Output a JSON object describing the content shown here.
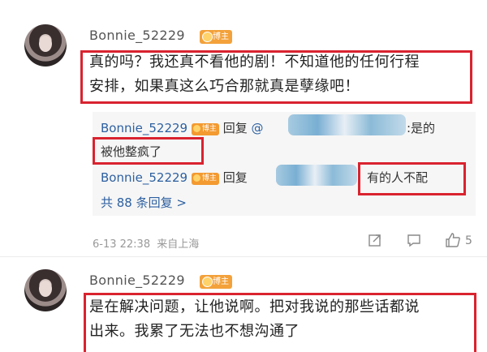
{
  "comment1": {
    "username": "Bonnie_52229",
    "badge": "博主",
    "text_line1": "真的吗？我还真不看他的剧！不知道他的任何行程",
    "text_line2": "安排，如果真这么巧合那就真是孽缘吧！",
    "replies": [
      {
        "username": "Bonnie_52229",
        "badge": "博主",
        "action": "回复",
        "at": "@",
        "suffix": ":是的",
        "text": "被他整疯了"
      },
      {
        "username": "Bonnie_52229",
        "badge": "博主",
        "action": "回复",
        "text": "有的人不配"
      }
    ],
    "reply_count": "共 88 条回复 >",
    "date": "6-13 22:38",
    "location": "来自上海",
    "like_count": "5",
    "icons": {
      "share": "share-icon",
      "comment": "comment-icon",
      "like": "thumbs-up-icon"
    }
  },
  "comment2": {
    "username": "Bonnie_52229",
    "badge": "博主",
    "text_line1": "是在解决问题，让他说啊。把对我说的那些话都说",
    "text_line2": "出来。我累了无法也不想沟通了"
  },
  "colors": {
    "highlight_border": "#d9232f",
    "badge": "#f3a13a",
    "link_blue": "#2d60a0"
  }
}
